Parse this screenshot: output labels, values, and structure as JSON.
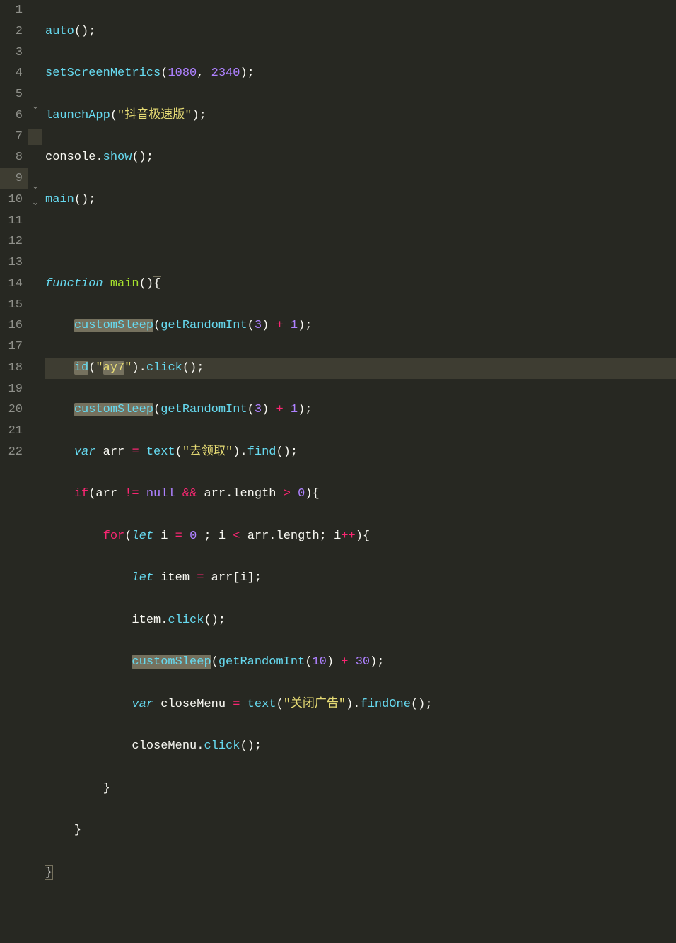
{
  "editor": {
    "language": "javascript",
    "theme": "monokai",
    "current_line": 9,
    "lines": [
      1,
      2,
      3,
      4,
      5,
      6,
      7,
      8,
      9,
      10,
      11,
      12,
      13,
      14,
      15,
      16,
      17,
      18,
      19,
      20,
      21,
      22
    ],
    "fold_markers": {
      "7": "open",
      "12": "open",
      "13": "open"
    }
  },
  "code": {
    "l1": {
      "fn_auto": "auto"
    },
    "l2": {
      "fn": "setScreenMetrics",
      "n1": "1080",
      "n2": "2340"
    },
    "l3": {
      "fn": "launchApp",
      "s": "\"抖音极速版\""
    },
    "l4": {
      "obj": "console",
      "m": "show"
    },
    "l5": {
      "fn": "main"
    },
    "l7": {
      "kw": "function",
      "name": "main"
    },
    "l8": {
      "fn1": "customSleep",
      "fn2": "getRandomInt",
      "n": "3",
      "n2": "1"
    },
    "l9": {
      "fn": "id",
      "s": "\"ay7\"",
      "m": "click"
    },
    "l10": {
      "fn1": "customSleep",
      "fn2": "getRandomInt",
      "n": "3",
      "n2": "1"
    },
    "l11": {
      "kw": "var",
      "v": "arr",
      "fn": "text",
      "s": "\"去领取\"",
      "m": "find"
    },
    "l12": {
      "kw": "if",
      "v": "arr",
      "nul": "null",
      "v2": "arr",
      "prop": "length",
      "n": "0"
    },
    "l13": {
      "kw": "for",
      "let": "let",
      "v": "i",
      "n0": "0",
      "v2": "i",
      "v3": "arr",
      "prop": "length",
      "v4": "i"
    },
    "l14": {
      "let": "let",
      "v": "item",
      "v2": "arr",
      "v3": "i"
    },
    "l15": {
      "v": "item",
      "m": "click"
    },
    "l16": {
      "fn1": "customSleep",
      "fn2": "getRandomInt",
      "n": "10",
      "n2": "30"
    },
    "l17": {
      "kw": "var",
      "v": "closeMenu",
      "fn": "text",
      "s": "\"关闭广告\"",
      "m": "findOne"
    },
    "l18": {
      "v": "closeMenu",
      "m": "click"
    }
  }
}
